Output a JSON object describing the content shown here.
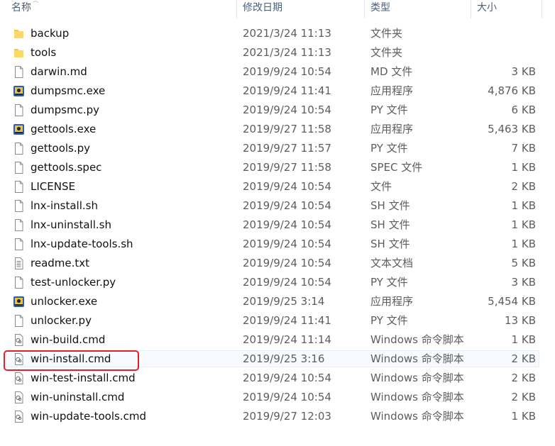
{
  "headers": {
    "name": "名称",
    "date": "修改日期",
    "type": "类型",
    "size": "大小"
  },
  "files": [
    {
      "name": "backup",
      "date": "2021/3/24 11:13",
      "type": "文件夹",
      "size": "",
      "icon": "folder-icon"
    },
    {
      "name": "tools",
      "date": "2021/3/24 11:13",
      "type": "文件夹",
      "size": "",
      "icon": "folder-icon"
    },
    {
      "name": "darwin.md",
      "date": "2019/9/24 10:54",
      "type": "MD 文件",
      "size": "3 KB",
      "icon": "file-icon"
    },
    {
      "name": "dumpsmc.exe",
      "date": "2019/9/24 11:41",
      "type": "应用程序",
      "size": "4,876 KB",
      "icon": "exe-icon"
    },
    {
      "name": "dumpsmc.py",
      "date": "2019/9/24 10:54",
      "type": "PY 文件",
      "size": "6 KB",
      "icon": "file-icon"
    },
    {
      "name": "gettools.exe",
      "date": "2019/9/27 11:58",
      "type": "应用程序",
      "size": "5,463 KB",
      "icon": "exe-icon"
    },
    {
      "name": "gettools.py",
      "date": "2019/9/27 11:57",
      "type": "PY 文件",
      "size": "7 KB",
      "icon": "file-icon"
    },
    {
      "name": "gettools.spec",
      "date": "2019/9/27 11:58",
      "type": "SPEC 文件",
      "size": "1 KB",
      "icon": "file-icon"
    },
    {
      "name": "LICENSE",
      "date": "2019/9/24 10:54",
      "type": "文件",
      "size": "2 KB",
      "icon": "file-icon"
    },
    {
      "name": "lnx-install.sh",
      "date": "2019/9/24 10:54",
      "type": "SH 文件",
      "size": "1 KB",
      "icon": "file-icon"
    },
    {
      "name": "lnx-uninstall.sh",
      "date": "2019/9/24 10:54",
      "type": "SH 文件",
      "size": "1 KB",
      "icon": "file-icon"
    },
    {
      "name": "lnx-update-tools.sh",
      "date": "2019/9/24 10:54",
      "type": "SH 文件",
      "size": "1 KB",
      "icon": "file-icon"
    },
    {
      "name": "readme.txt",
      "date": "2019/9/24 10:54",
      "type": "文本文档",
      "size": "5 KB",
      "icon": "text-file-icon"
    },
    {
      "name": "test-unlocker.py",
      "date": "2019/9/24 10:54",
      "type": "PY 文件",
      "size": "3 KB",
      "icon": "file-icon"
    },
    {
      "name": "unlocker.exe",
      "date": "2019/9/25 3:14",
      "type": "应用程序",
      "size": "5,454 KB",
      "icon": "exe-icon"
    },
    {
      "name": "unlocker.py",
      "date": "2019/9/24 11:41",
      "type": "PY 文件",
      "size": "13 KB",
      "icon": "file-icon"
    },
    {
      "name": "win-build.cmd",
      "date": "2019/9/24 11:14",
      "type": "Windows 命令脚本",
      "size": "1 KB",
      "icon": "cmd-file-icon"
    },
    {
      "name": "win-install.cmd",
      "date": "2019/9/25 3:16",
      "type": "Windows 命令脚本",
      "size": "2 KB",
      "icon": "cmd-file-icon",
      "highlighted": true
    },
    {
      "name": "win-test-install.cmd",
      "date": "2019/9/24 10:54",
      "type": "Windows 命令脚本",
      "size": "2 KB",
      "icon": "cmd-file-icon"
    },
    {
      "name": "win-uninstall.cmd",
      "date": "2019/9/24 10:54",
      "type": "Windows 命令脚本",
      "size": "2 KB",
      "icon": "cmd-file-icon"
    },
    {
      "name": "win-update-tools.cmd",
      "date": "2019/9/27 12:03",
      "type": "Windows 命令脚本",
      "size": "1 KB",
      "icon": "cmd-file-icon"
    }
  ],
  "colors": {
    "header_text": "#4c607a",
    "highlight_border": "#e0202a",
    "folder": "#f3c64b"
  }
}
